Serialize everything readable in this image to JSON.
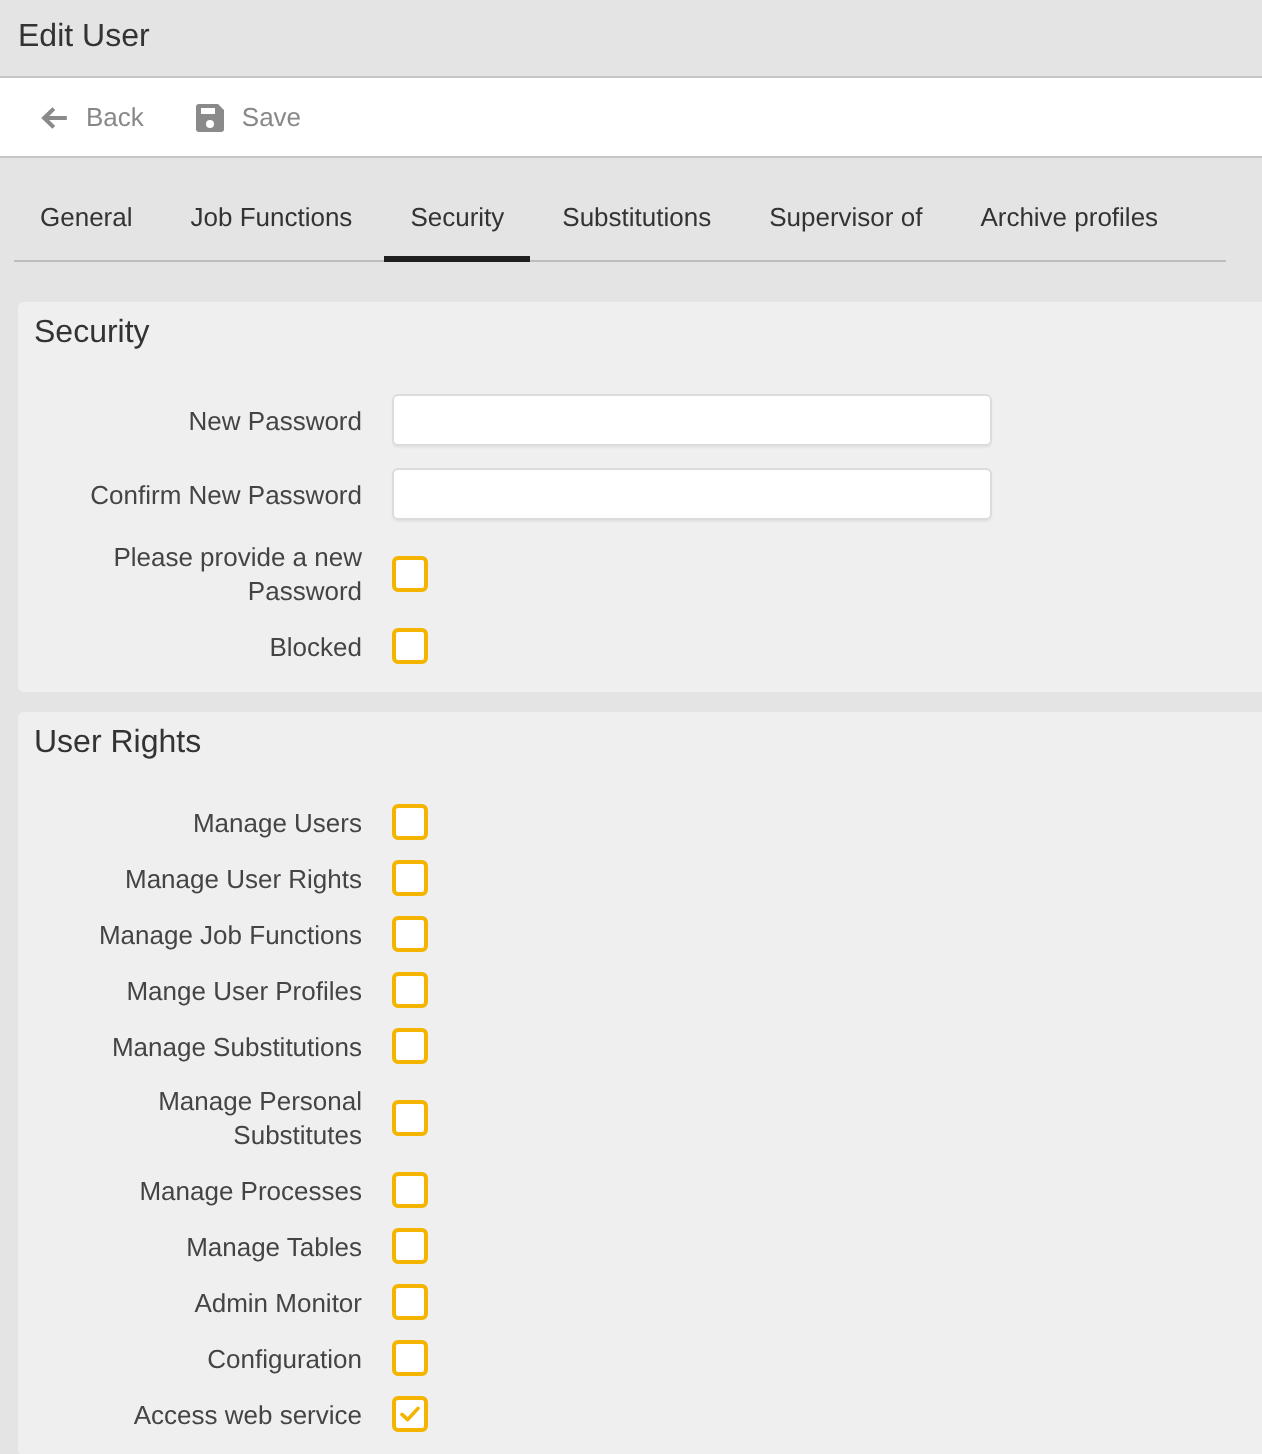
{
  "window": {
    "title": "Edit User"
  },
  "toolbar": [
    {
      "kind": "back",
      "label": "Back"
    },
    {
      "kind": "save",
      "label": "Save"
    }
  ],
  "tabs": [
    {
      "label": "General",
      "selected": false
    },
    {
      "label": "Job Functions",
      "selected": false
    },
    {
      "label": "Security",
      "selected": true
    },
    {
      "label": "Substitutions",
      "selected": false
    },
    {
      "label": "Supervisor of",
      "selected": false
    },
    {
      "label": "Archive profiles",
      "selected": false
    }
  ],
  "sections": [
    {
      "title": "Security",
      "fields": [
        {
          "kind": "password",
          "label": "New Password"
        },
        {
          "kind": "password",
          "label": "Confirm New Password"
        },
        {
          "kind": "checkbox",
          "label": "Please provide a new Password",
          "checked": false
        },
        {
          "kind": "checkbox",
          "label": "Blocked",
          "checked": false
        }
      ]
    },
    {
      "title": "User Rights",
      "fields": [
        {
          "kind": "checkbox",
          "label": "Manage Users",
          "checked": false
        },
        {
          "kind": "checkbox",
          "label": "Manage User Rights",
          "checked": false
        },
        {
          "kind": "checkbox",
          "label": "Manage Job Functions",
          "checked": false
        },
        {
          "kind": "checkbox",
          "label": "Mange User Profiles",
          "checked": false
        },
        {
          "kind": "checkbox",
          "label": "Manage Substitutions",
          "checked": false
        },
        {
          "kind": "checkbox",
          "label": "Manage Personal Substitutes",
          "checked": false
        },
        {
          "kind": "checkbox",
          "label": "Manage Processes",
          "checked": false
        },
        {
          "kind": "checkbox",
          "label": "Manage Tables",
          "checked": false
        },
        {
          "kind": "checkbox",
          "label": "Admin Monitor",
          "checked": false
        },
        {
          "kind": "checkbox",
          "label": "Configuration",
          "checked": false
        },
        {
          "kind": "checkbox",
          "label": "Access web service",
          "checked": true
        }
      ]
    }
  ]
}
